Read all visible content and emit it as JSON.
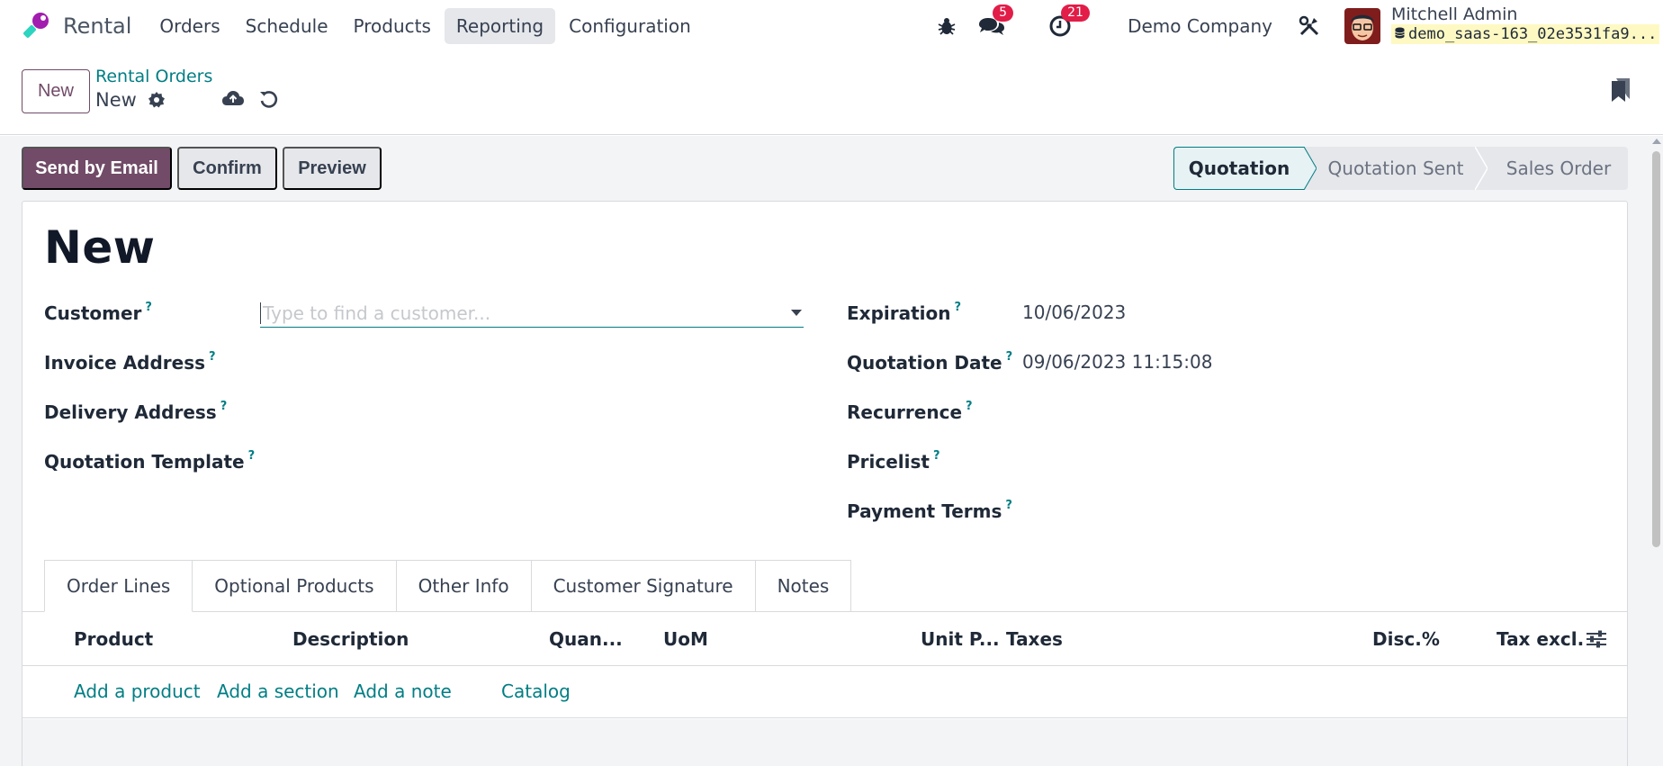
{
  "app": {
    "brand_name": "Rental",
    "menu": [
      "Orders",
      "Schedule",
      "Products",
      "Reporting",
      "Configuration"
    ],
    "active_menu": "Reporting"
  },
  "systray": {
    "messages_count": "5",
    "activities_count": "21",
    "company": "Demo Company",
    "user_name": "Mitchell Admin",
    "db_name": "demo_saas-163_02e3531fa9..."
  },
  "control_panel": {
    "new_label": "New",
    "breadcrumb_parent": "Rental Orders",
    "breadcrumb_current": "New"
  },
  "statusbar": {
    "buttons": [
      "Send by Email",
      "Confirm",
      "Preview"
    ],
    "stages": [
      "Quotation",
      "Quotation Sent",
      "Sales Order"
    ],
    "current_stage": "Quotation"
  },
  "form": {
    "title": "New",
    "left_fields": [
      {
        "label": "Customer",
        "help": "?"
      },
      {
        "label": "Invoice Address",
        "help": "?"
      },
      {
        "label": "Delivery Address",
        "help": "?"
      },
      {
        "label": "Quotation Template",
        "help": "?"
      }
    ],
    "customer_placeholder": "Type to find a customer...",
    "right_fields": [
      {
        "label": "Expiration",
        "help": "?",
        "value": "10/06/2023"
      },
      {
        "label": "Quotation Date",
        "help": "?",
        "value": "09/06/2023 11:15:08"
      },
      {
        "label": "Recurrence",
        "help": "?",
        "value": ""
      },
      {
        "label": "Pricelist",
        "help": "?",
        "value": ""
      },
      {
        "label": "Payment Terms",
        "help": "?",
        "value": ""
      }
    ]
  },
  "tabs": [
    "Order Lines",
    "Optional Products",
    "Other Info",
    "Customer Signature",
    "Notes"
  ],
  "order_lines": {
    "columns": [
      "Product",
      "Description",
      "Quan...",
      "UoM",
      "Unit P...",
      "Taxes",
      "Disc.%",
      "Tax excl."
    ],
    "actions": [
      "Add a product",
      "Add a section",
      "Add a note",
      "Catalog"
    ]
  },
  "colors": {
    "primary": "#714b67",
    "link": "#017e84",
    "badge": "#e11d48",
    "db_highlight": "#fef9c3"
  },
  "icons": [
    "brand-logo-icon",
    "bug-icon",
    "chat-icon",
    "clock-icon",
    "tools-icon",
    "gear-icon",
    "cloud-upload-icon",
    "undo-icon",
    "bookmark-icon",
    "column-settings-icon",
    "caret-down-icon"
  ]
}
